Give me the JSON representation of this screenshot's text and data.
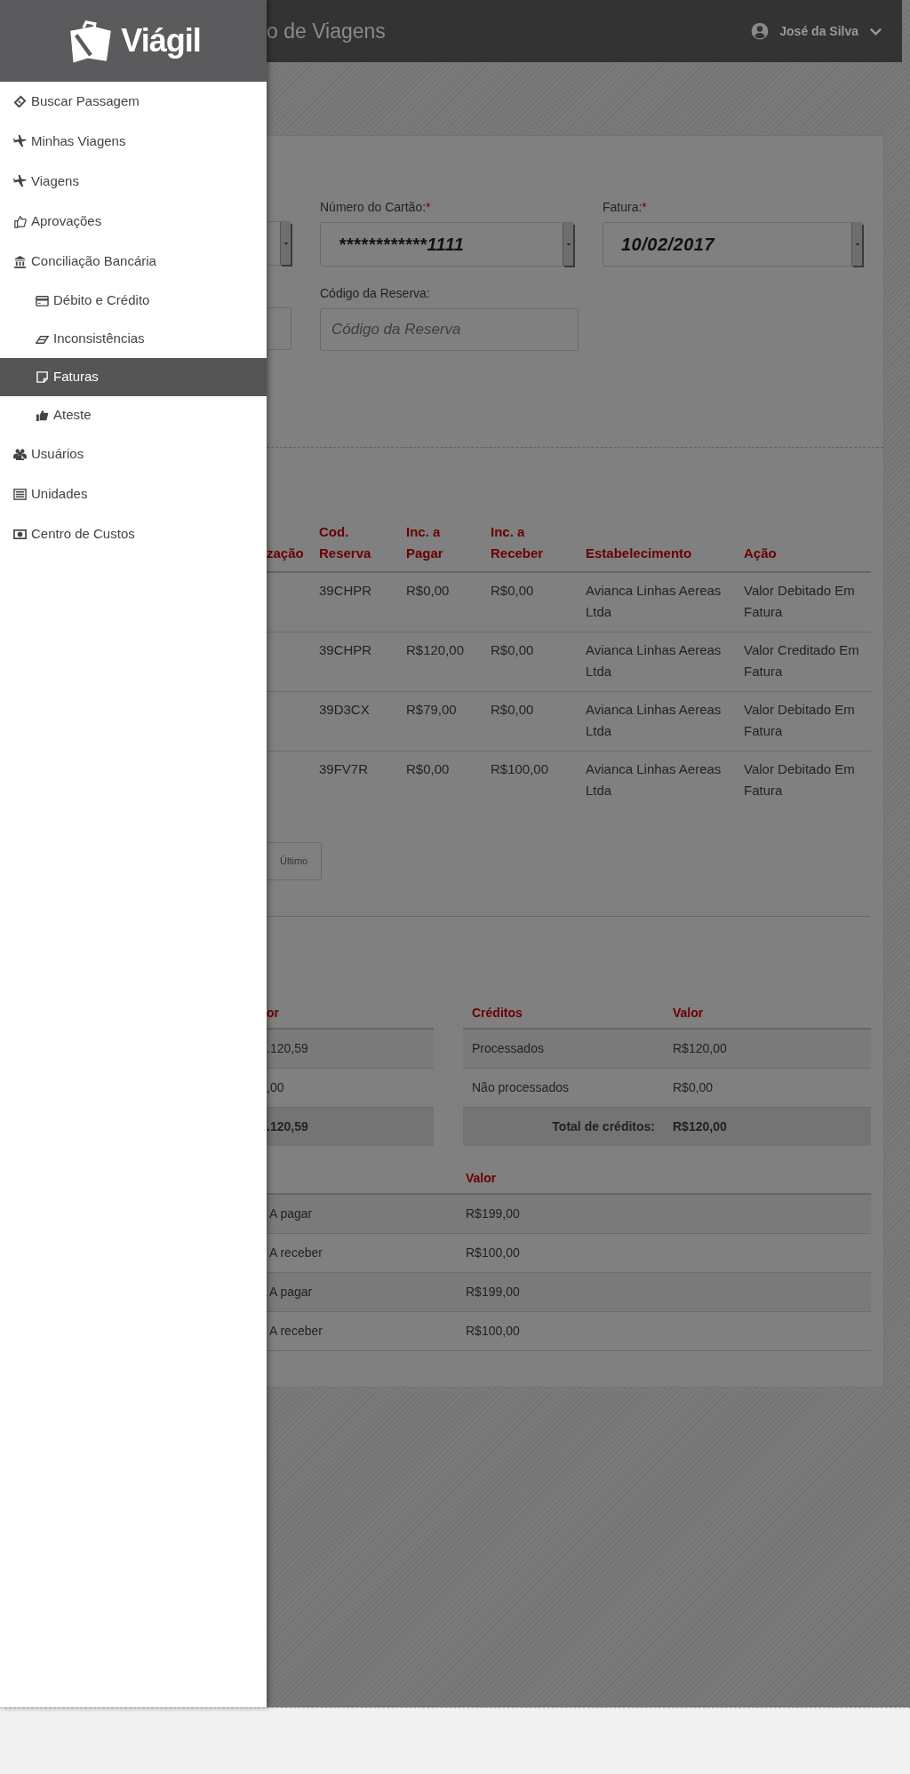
{
  "header": {
    "title": "o de Viagens",
    "user": "José da Silva"
  },
  "sidebar": {
    "logo_text": "Viágil",
    "items": [
      {
        "label": "Buscar Passagem",
        "selected": false
      },
      {
        "label": "Minhas Viagens",
        "selected": false
      },
      {
        "label": "Viagens",
        "selected": false
      },
      {
        "label": "Aprovações",
        "selected": false
      },
      {
        "label": "Conciliação Bancária",
        "selected": false,
        "children": [
          {
            "label": "Débito e Crédito",
            "selected": false
          },
          {
            "label": "Inconsistências",
            "selected": false
          },
          {
            "label": "Faturas",
            "selected": true
          },
          {
            "label": "Ateste",
            "selected": false
          }
        ]
      },
      {
        "label": "Usuários",
        "selected": false
      },
      {
        "label": "Unidades",
        "selected": false
      },
      {
        "label": "Centro de Custos",
        "selected": false
      }
    ]
  },
  "form": {
    "rows": [
      [
        {
          "kind": "select"
        },
        {
          "kind": "select",
          "label": "Número do Cartão:",
          "required_mark": "*",
          "value": "************1111"
        },
        {
          "kind": "select",
          "label": "Fatura:",
          "required_mark": "*",
          "value": "10/02/2017"
        }
      ],
      [
        {
          "kind": "input"
        },
        {
          "kind": "input",
          "label": "Código da Reserva:",
          "placeholder": "Código da Reserva"
        }
      ]
    ]
  },
  "table": {
    "columns": [
      "zação",
      "Cod. Reserva",
      "Inc. a Pagar",
      "Inc. a Receber",
      "Estabelecimento",
      "Ação"
    ],
    "rows": [
      [
        "",
        "39CHPR",
        "R$0,00",
        "R$0,00",
        "Avianca Linhas Aereas Ltda",
        "Valor Debitado Em Fatura"
      ],
      [
        "",
        "39CHPR",
        "R$120,00",
        "R$0,00",
        "Avianca Linhas Aereas Ltda",
        "Valor Creditado Em Fatura"
      ],
      [
        "",
        "39D3CX",
        "R$79,00",
        "R$0,00",
        "Avianca Linhas Aereas Ltda",
        "Valor Debitado Em Fatura"
      ],
      [
        "",
        "39FV7R",
        "R$0,00",
        "R$100,00",
        "Avianca Linhas Aereas Ltda",
        "Valor Debitado Em Fatura"
      ]
    ]
  },
  "pagination": [
    "Último"
  ],
  "debits": {
    "header": "or",
    "rows": [
      ".120,59",
      ",00"
    ],
    "total": ".120,59"
  },
  "credits": {
    "columns": [
      "Créditos",
      "Valor"
    ],
    "rows": [
      [
        "Processados",
        "R$120,00"
      ],
      [
        "Não processados",
        "R$0,00"
      ]
    ],
    "total_label": "Total de créditos:",
    "total_value": "R$120,00"
  },
  "balances": {
    "column": "Valor",
    "rows": [
      [
        "A pagar",
        "R$199,00"
      ],
      [
        "A receber",
        "R$100,00"
      ],
      [
        "A pagar",
        "R$199,00"
      ],
      [
        "A receber",
        "R$100,00"
      ]
    ]
  }
}
